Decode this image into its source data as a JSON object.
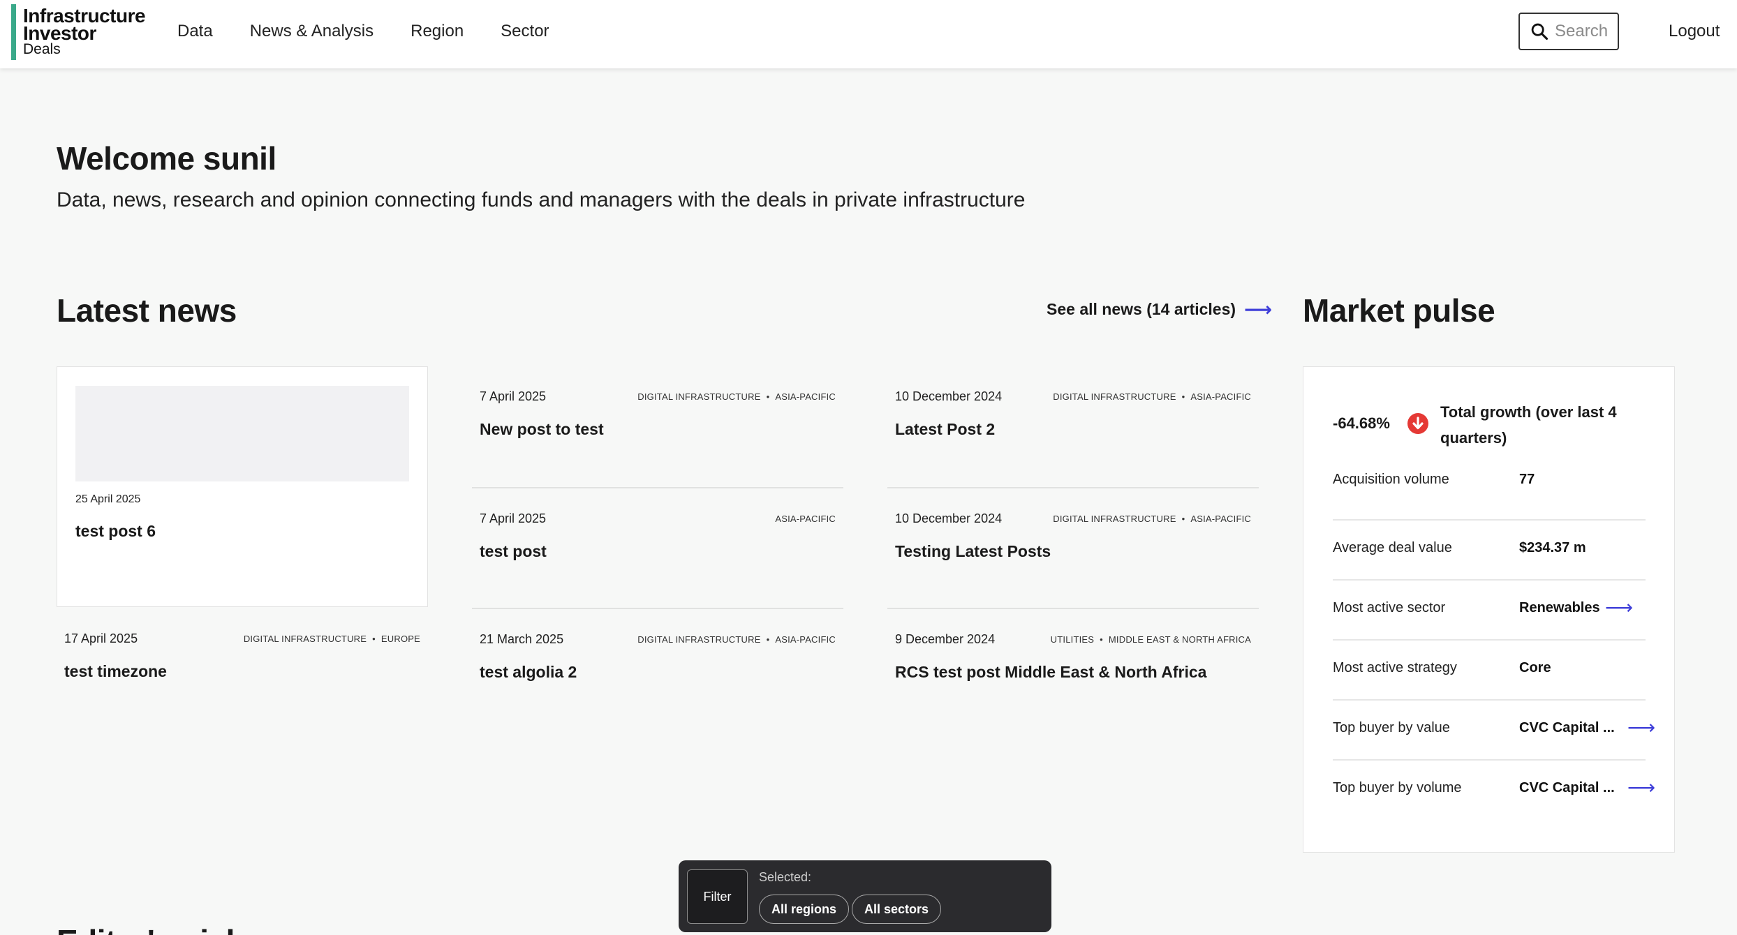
{
  "header": {
    "logo": {
      "line1": "Infrastructure",
      "line2": "Investor",
      "line3": "Deals"
    },
    "nav": [
      "Data",
      "News & Analysis",
      "Region",
      "Sector"
    ],
    "search_placeholder": "Search",
    "logout": "Logout"
  },
  "hero": {
    "welcome": "Welcome sunil",
    "tagline": "Data, news, research and opinion connecting funds and managers with the deals in private infrastructure"
  },
  "latest_news": {
    "title": "Latest news",
    "see_all": "See all news (14 articles)",
    "featured": {
      "date": "25 April 2025",
      "title": "test post 6"
    },
    "items": [
      {
        "date": "7 April 2025",
        "tags": [
          "Digital Infrastructure",
          "Asia-Pacific"
        ],
        "title": "New post to test"
      },
      {
        "date": "10 December 2024",
        "tags": [
          "Digital Infrastructure",
          "Asia-Pacific"
        ],
        "title": "Latest Post 2"
      },
      {
        "date": "7 April 2025",
        "tags": [
          "Asia-Pacific"
        ],
        "title": "test post"
      },
      {
        "date": "10 December 2024",
        "tags": [
          "Digital Infrastructure",
          "Asia-Pacific"
        ],
        "title": "Testing Latest Posts"
      },
      {
        "date": "17 April 2025",
        "tags": [
          "Digital Infrastructure",
          "Europe"
        ],
        "title": "test timezone"
      },
      {
        "date": "21 March 2025",
        "tags": [
          "Digital Infrastructure",
          "Asia-Pacific"
        ],
        "title": "test algolia 2"
      },
      {
        "date": "9 December 2024",
        "tags": [
          "Utilities",
          "Middle East & North Africa"
        ],
        "title": "RCS test post Middle East & North Africa"
      }
    ]
  },
  "market_pulse": {
    "title": "Market pulse",
    "growth_value": "-64.68%",
    "growth_label": "Total growth (over last 4 quarters)",
    "rows": [
      {
        "label": "Acquisition volume",
        "value": "77"
      },
      {
        "label": "Average deal value",
        "value": "$234.37 m"
      },
      {
        "label": "Most active sector",
        "value": "Renewables"
      },
      {
        "label": "Most active strategy",
        "value": "Core"
      },
      {
        "label": "Top buyer by value",
        "value": "CVC Capital ..."
      },
      {
        "label": "Top buyer by volume",
        "value": "CVC Capital ..."
      }
    ]
  },
  "filter_bar": {
    "filter_label": "Filter",
    "selected_label": "Selected:",
    "chips": [
      "All regions",
      "All sectors"
    ]
  },
  "next_section_title": "Editor's pick",
  "colors": {
    "accent": "#3f3fd9",
    "brand": "#3aa98a",
    "down": "#e53935"
  }
}
